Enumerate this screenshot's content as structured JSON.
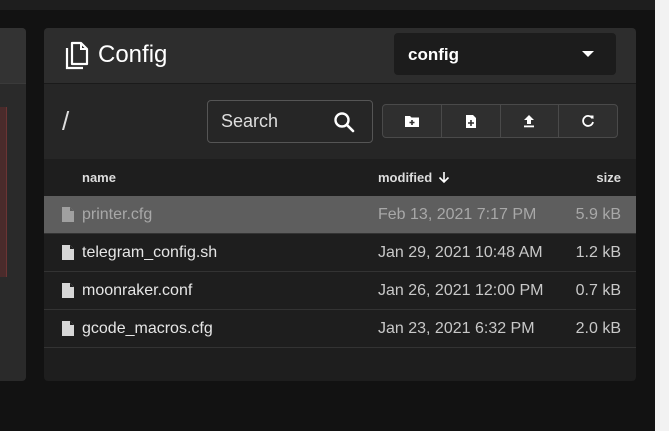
{
  "panel": {
    "title": "Config",
    "root_selected": "config",
    "path": "/",
    "search_placeholder": "Search"
  },
  "toolbar_icons": [
    "add-folder-icon",
    "add-file-icon",
    "upload-icon",
    "refresh-icon"
  ],
  "table": {
    "columns": {
      "name": "name",
      "modified": "modified",
      "size": "size"
    },
    "sort": {
      "column": "modified",
      "direction": "descending"
    },
    "rows": [
      {
        "name": "printer.cfg",
        "modified": "Feb 13, 2021 7:17 PM",
        "size": "5.9 kB",
        "selected": true
      },
      {
        "name": "telegram_config.sh",
        "modified": "Jan 29, 2021 10:48 AM",
        "size": "1.2 kB"
      },
      {
        "name": "moonraker.conf",
        "modified": "Jan 26, 2021 12:00 PM",
        "size": "0.7 kB"
      },
      {
        "name": "gcode_macros.cfg",
        "modified": "Jan 23, 2021 6:32 PM",
        "size": "2.0 kB"
      }
    ]
  },
  "colors": {
    "card": "#1e1e1e",
    "header": "#2d2d2d",
    "selected_row": "#5e5e5e"
  }
}
